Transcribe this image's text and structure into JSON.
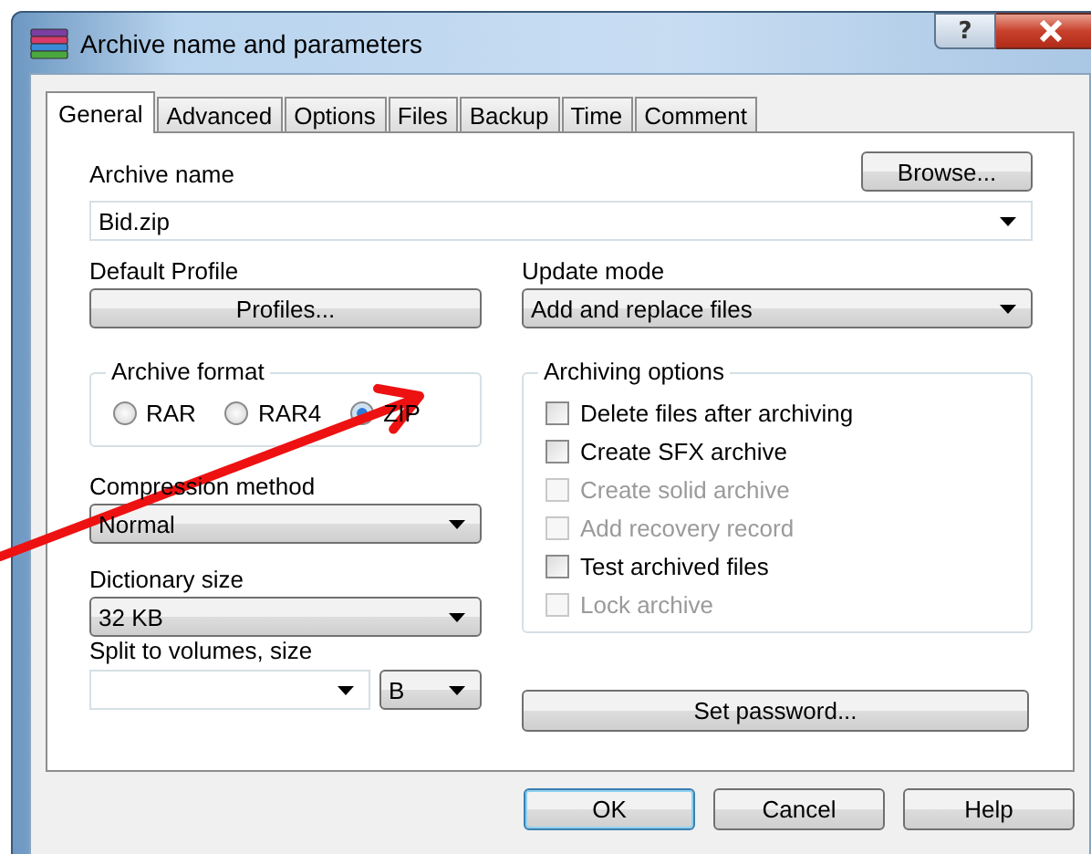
{
  "window": {
    "title": "Archive name and parameters",
    "help_glyph": "?"
  },
  "tabs": [
    {
      "label": "General",
      "selected": true
    },
    {
      "label": "Advanced",
      "selected": false
    },
    {
      "label": "Options",
      "selected": false
    },
    {
      "label": "Files",
      "selected": false
    },
    {
      "label": "Backup",
      "selected": false
    },
    {
      "label": "Time",
      "selected": false
    },
    {
      "label": "Comment",
      "selected": false
    }
  ],
  "archive_name": {
    "label": "Archive name",
    "value": "Bid.zip",
    "button": "Browse..."
  },
  "default_profile": {
    "label": "Default Profile",
    "button": "Profiles..."
  },
  "update_mode": {
    "label": "Update mode",
    "value": "Add and replace files"
  },
  "archive_format": {
    "title": "Archive format",
    "options": [
      {
        "label": "RAR",
        "selected": false
      },
      {
        "label": "RAR4",
        "selected": false
      },
      {
        "label": "ZIP",
        "selected": true
      }
    ]
  },
  "compression_method": {
    "label": "Compression method",
    "value": "Normal"
  },
  "dictionary_size": {
    "label": "Dictionary size",
    "value": "32 KB"
  },
  "split_volumes": {
    "label": "Split to volumes, size",
    "unit": "B"
  },
  "archiving_options": {
    "title": "Archiving options",
    "options": [
      {
        "label": "Delete files after archiving",
        "checked": false,
        "disabled": false
      },
      {
        "label": "Create SFX archive",
        "checked": false,
        "disabled": false
      },
      {
        "label": "Create solid archive",
        "checked": false,
        "disabled": true
      },
      {
        "label": "Add recovery record",
        "checked": false,
        "disabled": true
      },
      {
        "label": "Test archived files",
        "checked": false,
        "disabled": false
      },
      {
        "label": "Lock archive",
        "checked": false,
        "disabled": true
      }
    ]
  },
  "set_password_button": "Set password...",
  "buttons": [
    {
      "label": "OK",
      "default": true
    },
    {
      "label": "Cancel",
      "default": false
    },
    {
      "label": "Help",
      "default": false
    }
  ]
}
